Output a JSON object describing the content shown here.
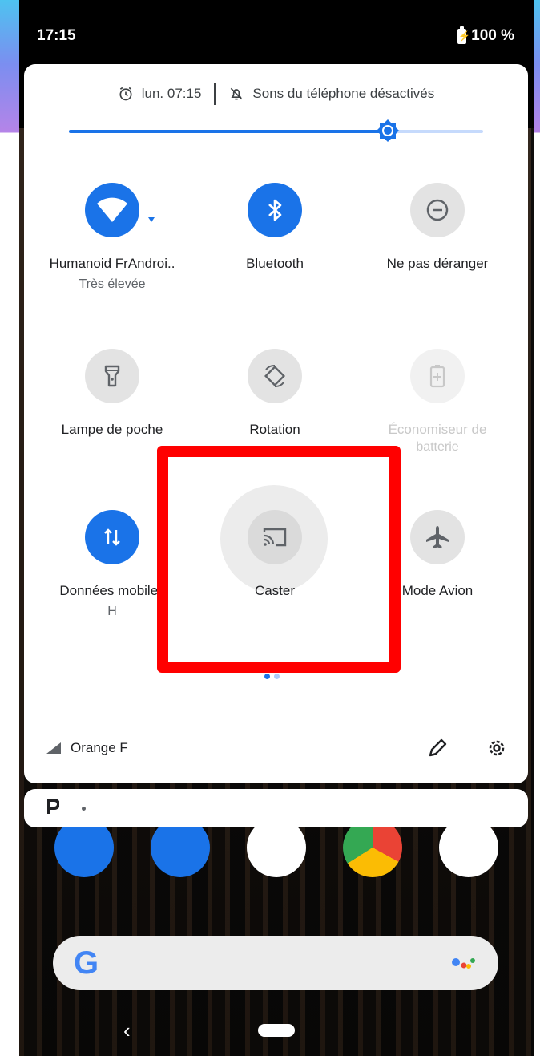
{
  "status_bar": {
    "time": "17:15",
    "battery": "100 %"
  },
  "header": {
    "alarm": "lun. 07:15",
    "sound_status": "Sons du téléphone désactivés"
  },
  "brightness": {
    "level": 0.77
  },
  "tiles": [
    {
      "label": "Humanoid FrAndroi..",
      "sub": "Très élevée",
      "state": "on",
      "icon": "wifi-icon"
    },
    {
      "label": "Bluetooth",
      "sub": "",
      "state": "on",
      "icon": "bluetooth-icon"
    },
    {
      "label": "Ne pas déranger",
      "sub": "",
      "state": "off",
      "icon": "dnd-icon"
    },
    {
      "label": "Lampe de poche",
      "sub": "",
      "state": "off",
      "icon": "flashlight-icon"
    },
    {
      "label": "Rotation",
      "sub": "",
      "state": "off",
      "icon": "rotation-icon"
    },
    {
      "label": "Économiseur de",
      "sub": "batterie",
      "state": "disabled",
      "icon": "battery-saver-icon"
    },
    {
      "label": "Données mobiles",
      "sub": "H",
      "state": "on",
      "icon": "mobile-data-icon"
    },
    {
      "label": "Caster",
      "sub": "",
      "state": "off",
      "icon": "cast-icon"
    },
    {
      "label": "Mode Avion",
      "sub": "",
      "state": "off",
      "icon": "airplane-icon"
    }
  ],
  "footer": {
    "carrier": "Orange F"
  },
  "notification": {
    "app_letter": "P"
  },
  "colors": {
    "accent": "#1a73e8",
    "highlight": "#ff0000"
  }
}
